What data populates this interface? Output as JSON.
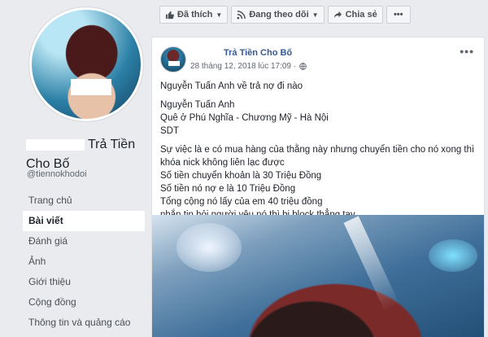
{
  "profile": {
    "name_visible": "Trả Tiền Cho Bố",
    "handle": "@tiennokhodoi"
  },
  "nav": [
    {
      "label": "Trang chủ",
      "active": false
    },
    {
      "label": "Bài viết",
      "active": true
    },
    {
      "label": "Đánh giá",
      "active": false
    },
    {
      "label": "Ảnh",
      "active": false
    },
    {
      "label": "Giới thiệu",
      "active": false
    },
    {
      "label": "Cộng đồng",
      "active": false
    },
    {
      "label": "Thông tin và quảng cáo",
      "active": false
    }
  ],
  "actions": {
    "liked": "Đã thích",
    "following": "Đang theo dõi",
    "share": "Chia sẻ",
    "more": "•••"
  },
  "post": {
    "author": "Trả Tiền Cho Bố",
    "timestamp": "28 tháng 12, 2018 lúc 17:09 ·",
    "more": "•••",
    "lines": [
      "Nguyễn Tuấn Anh về trả nợ đi nào",
      "",
      "Nguyễn Tuấn Anh",
      "Quê ở Phú Nghĩa - Chương Mỹ - Hà Nội",
      "SDT",
      "",
      "Sự việc là e có mua hàng của thằng này nhưng chuyển tiền cho nó xong thì khóa nick không liên lạc được",
      "Số tiền chuyển khoản là 30 Triệu Đồng",
      "Số tiền nó nợ e là 10 Triệu Đồng",
      "Tổng cộng nó lấy của em 40 triệu đồng",
      "nhắn tin hỏi người yêu nó thì bị block thẳng tay"
    ]
  },
  "colors": {
    "link": "#365899",
    "page_bg": "#e9ebee"
  }
}
